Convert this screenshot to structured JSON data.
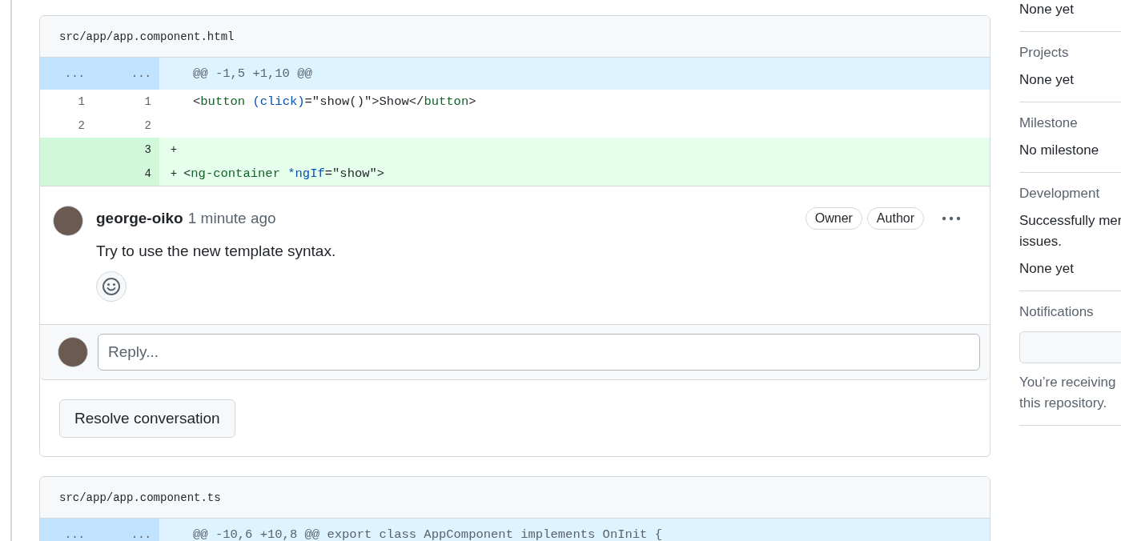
{
  "files": [
    {
      "path": "src/app/app.component.html",
      "rows": [
        {
          "kind": "hunk",
          "old": "...",
          "new": "...",
          "tokens": [
            {
              "kind": "plain",
              "text": "@@ -1,5 +1,10 @@"
            }
          ]
        },
        {
          "kind": "context",
          "old": "1",
          "new": "1",
          "tokens": [
            {
              "kind": "plain",
              "text": "<"
            },
            {
              "kind": "tag",
              "text": "button"
            },
            {
              "kind": "attr",
              "text": " (click)"
            },
            {
              "kind": "plain",
              "text": "=\"show()\">Show</"
            },
            {
              "kind": "tag",
              "text": "button"
            },
            {
              "kind": "plain",
              "text": ">"
            }
          ]
        },
        {
          "kind": "context",
          "old": "2",
          "new": "2",
          "tokens": []
        },
        {
          "kind": "addition",
          "old": "",
          "new": "3",
          "sign": "+",
          "tokens": []
        },
        {
          "kind": "addition",
          "old": "",
          "new": "4",
          "sign": "+",
          "tokens": [
            {
              "kind": "plain",
              "text": "<"
            },
            {
              "kind": "tag",
              "text": "ng-container"
            },
            {
              "kind": "attr",
              "text": " *ngIf"
            },
            {
              "kind": "plain",
              "text": "=\"show\">"
            }
          ]
        }
      ],
      "comment": {
        "author": "george-oiko",
        "time": "1 minute ago",
        "badges": [
          "Owner",
          "Author"
        ],
        "body": "Try to use the new template syntax."
      },
      "reply": {
        "placeholder": "Reply..."
      },
      "resolve_button": "Resolve conversation"
    },
    {
      "path": "src/app/app.component.ts",
      "rows": [
        {
          "kind": "hunk",
          "old": "...",
          "new": "...",
          "tokens": [
            {
              "kind": "plain",
              "text": "@@ -10,6 +10,8 @@ export class AppComponent implements OnInit {"
            }
          ]
        }
      ]
    }
  ],
  "sidebar": {
    "sections": [
      {
        "kind": "value",
        "lines": [
          "None yet"
        ]
      },
      {
        "kind": "section",
        "heading": "Projects",
        "lines": [
          "None yet"
        ]
      },
      {
        "kind": "section",
        "heading": "Milestone",
        "lines": [
          "No milestone"
        ]
      },
      {
        "kind": "section",
        "heading": "Development",
        "lines": [
          "Successfully mer",
          "issues."
        ],
        "extra": "None yet"
      },
      {
        "kind": "notifications",
        "heading": "Notifications",
        "lines": [
          "You’re receiving",
          "this repository."
        ]
      }
    ]
  }
}
